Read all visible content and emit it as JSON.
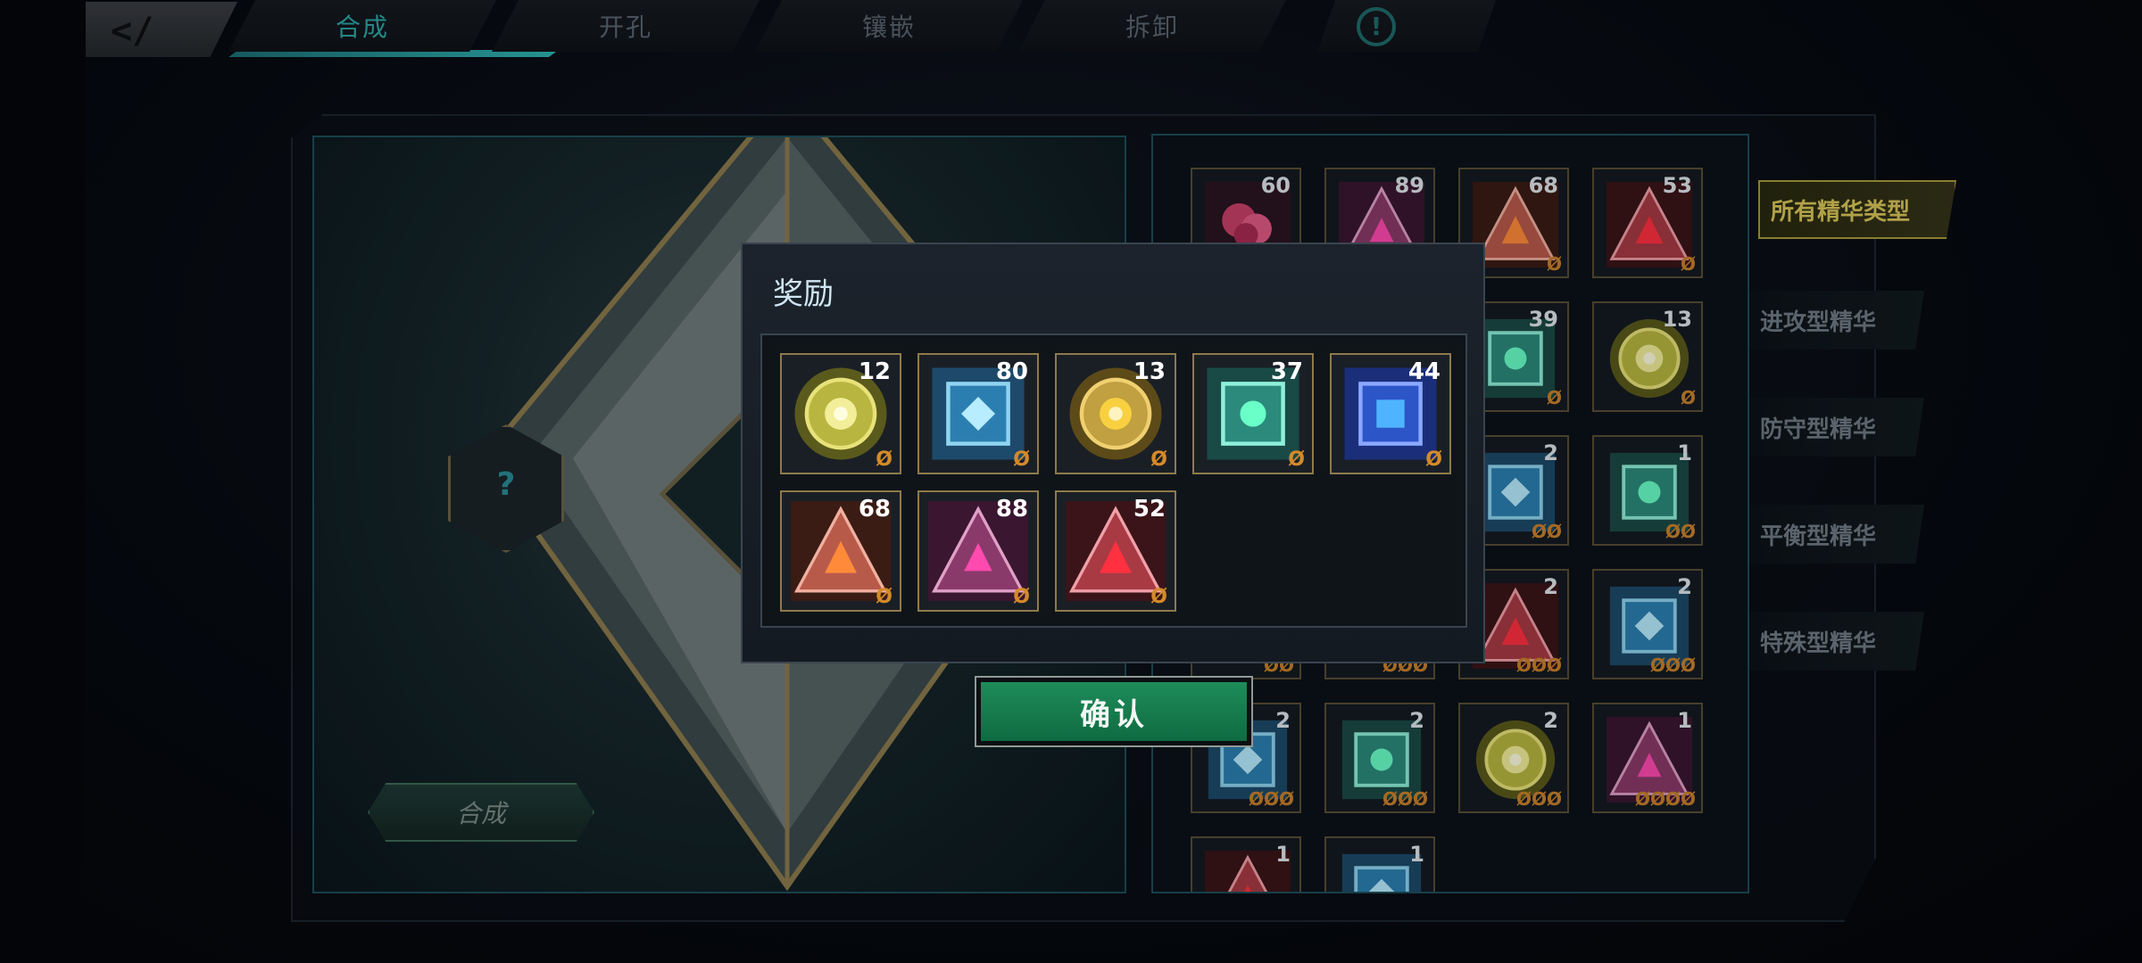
{
  "tabs": [
    {
      "label": "合成",
      "active": true
    },
    {
      "label": "开孔",
      "active": false
    },
    {
      "label": "镶嵌",
      "active": false
    },
    {
      "label": "拆卸",
      "active": false
    }
  ],
  "info_icon": "exclamation-circle-icon",
  "back_icon": "back-arrow-icon",
  "craft": {
    "slot_symbol": "?",
    "button_label": "合成"
  },
  "inventory": [
    {
      "count": "60",
      "slots": "",
      "kind": "flower"
    },
    {
      "count": "89",
      "slots": "",
      "kind": "tri-pink"
    },
    {
      "count": "68",
      "slots": "Ø",
      "kind": "tri-orange"
    },
    {
      "count": "53",
      "slots": "Ø",
      "kind": "tri-red"
    },
    {
      "count": "",
      "slots": "",
      "kind": "hidden"
    },
    {
      "count": "",
      "slots": "",
      "kind": "hidden"
    },
    {
      "count": "39",
      "slots": "Ø",
      "kind": "sq-green"
    },
    {
      "count": "13",
      "slots": "Ø",
      "kind": "circ-yellow"
    },
    {
      "count": "",
      "slots": "",
      "kind": "hidden"
    },
    {
      "count": "",
      "slots": "",
      "kind": "hidden"
    },
    {
      "count": "2",
      "slots": "ØØ",
      "kind": "sq-blue"
    },
    {
      "count": "1",
      "slots": "ØØ",
      "kind": "sq-green"
    },
    {
      "count": "",
      "slots": "ØØ",
      "kind": "hidden"
    },
    {
      "count": "",
      "slots": "ØØØ",
      "kind": "hidden"
    },
    {
      "count": "2",
      "slots": "ØØØ",
      "kind": "tri-red"
    },
    {
      "count": "2",
      "slots": "ØØØ",
      "kind": "sq-blue"
    },
    {
      "count": "2",
      "slots": "ØØØ",
      "kind": "sq-blue"
    },
    {
      "count": "2",
      "slots": "ØØØ",
      "kind": "sq-green"
    },
    {
      "count": "2",
      "slots": "ØØØ",
      "kind": "circ-yellow"
    },
    {
      "count": "1",
      "slots": "ØØØØ",
      "kind": "tri-pink"
    },
    {
      "count": "1",
      "slots": "",
      "kind": "tri-red"
    },
    {
      "count": "1",
      "slots": "",
      "kind": "sq-blue"
    }
  ],
  "categories": [
    {
      "label": "所有精华类型",
      "active": true
    },
    {
      "label": "进攻型精华",
      "active": false
    },
    {
      "label": "防守型精华",
      "active": false
    },
    {
      "label": "平衡型精华",
      "active": false
    },
    {
      "label": "特殊型精华",
      "active": false
    }
  ],
  "dialog": {
    "title": "奖励",
    "rewards": [
      {
        "count": "12",
        "slots": "Ø",
        "kind": "circ-yellow"
      },
      {
        "count": "80",
        "slots": "Ø",
        "kind": "sq-blue"
      },
      {
        "count": "13",
        "slots": "Ø",
        "kind": "circ-gold"
      },
      {
        "count": "37",
        "slots": "Ø",
        "kind": "sq-green"
      },
      {
        "count": "44",
        "slots": "Ø",
        "kind": "sq-royal"
      },
      {
        "count": "68",
        "slots": "Ø",
        "kind": "tri-orange"
      },
      {
        "count": "88",
        "slots": "Ø",
        "kind": "tri-pink"
      },
      {
        "count": "52",
        "slots": "Ø",
        "kind": "tri-red"
      }
    ],
    "confirm_label": "确认"
  },
  "colors": {
    "accent_teal": "#2ca7a7",
    "confirm_green": "#1e8c5a",
    "category_gold": "#d8c55a",
    "slot_orange": "#d48a2a"
  }
}
